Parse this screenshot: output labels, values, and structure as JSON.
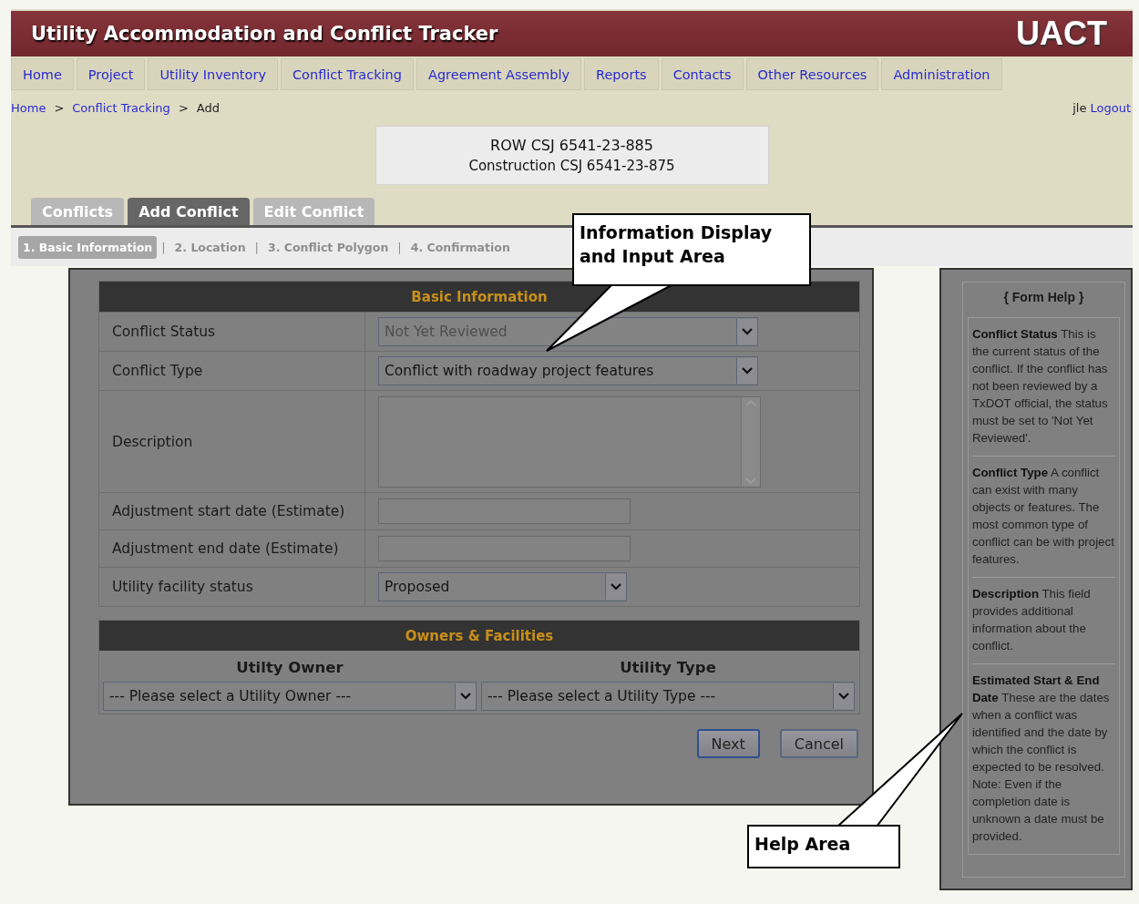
{
  "header": {
    "title": "Utility Accommodation and Conflict Tracker",
    "logo": "UACT"
  },
  "nav": [
    "Home",
    "Project",
    "Utility Inventory",
    "Conflict Tracking",
    "Agreement Assembly",
    "Reports",
    "Contacts",
    "Other Resources",
    "Administration"
  ],
  "breadcrumb": {
    "separator": ">",
    "items": [
      {
        "label": "Home",
        "kind": "link"
      },
      {
        "label": "Conflict Tracking",
        "kind": "link"
      },
      {
        "label": "Add",
        "kind": "current"
      }
    ]
  },
  "user": {
    "name": "jle",
    "logout": "Logout"
  },
  "project": [
    "ROW CSJ 6541-23-885",
    "Construction CSJ 6541-23-875"
  ],
  "tabs": [
    {
      "label": "Conflicts",
      "selected": false
    },
    {
      "label": "Add Conflict",
      "selected": true
    },
    {
      "label": "Edit Conflict",
      "selected": false
    }
  ],
  "steps": {
    "separator": "|",
    "items": [
      {
        "label": "1. Basic Information",
        "selected": true
      },
      {
        "label": "2. Location",
        "selected": false
      },
      {
        "label": "3. Conflict Polygon",
        "selected": false
      },
      {
        "label": "4. Confirmation",
        "selected": false
      }
    ]
  },
  "basic_information": {
    "title": "Basic Information",
    "fields": [
      {
        "label": "Conflict Status",
        "kind": "select",
        "value": "Not Yet Reviewed",
        "disabled": true
      },
      {
        "label": "Conflict Type",
        "kind": "select",
        "value": "Conflict with roadway project features",
        "disabled": false
      },
      {
        "label": "Description",
        "kind": "textarea"
      },
      {
        "label": "Adjustment start date (Estimate)",
        "kind": "text"
      },
      {
        "label": "Adjustment end date (Estimate)",
        "kind": "text"
      },
      {
        "label": "Utility facility status",
        "kind": "select",
        "value": "Proposed",
        "disabled": false
      }
    ]
  },
  "owners_facilities": {
    "title": "Owners & Facilities",
    "columns": [
      {
        "heading": "Utilty Owner",
        "value": "--- Please select a Utility Owner ---"
      },
      {
        "heading": "Utility Type",
        "value": "--- Please select a Utility Type ---"
      }
    ]
  },
  "buttons": [
    {
      "label": "Next",
      "default": true
    },
    {
      "label": "Cancel",
      "default": false
    }
  ],
  "help": {
    "title": "{ Form Help }",
    "entries": [
      "**Conflict Status** This is the current status of the conflict. If the conflict has not been reviewed by a TxDOT official, the status must be set to 'Not Yet Reviewed'.",
      "**Conflict Type** A conflict can exist with many objects or features. The most common type of conflict can be with project features.",
      "**Description** This field provides additional information about the conflict.",
      "**Estimated Start & End Date** These are the dates when a conflict was identified and the date by which the conflict is expected to be resolved. Note: Even if the completion date is unknown a date must be provided."
    ]
  },
  "callouts": [
    {
      "text": "Information Display and Input Area"
    },
    {
      "text": "Help Area"
    }
  ]
}
